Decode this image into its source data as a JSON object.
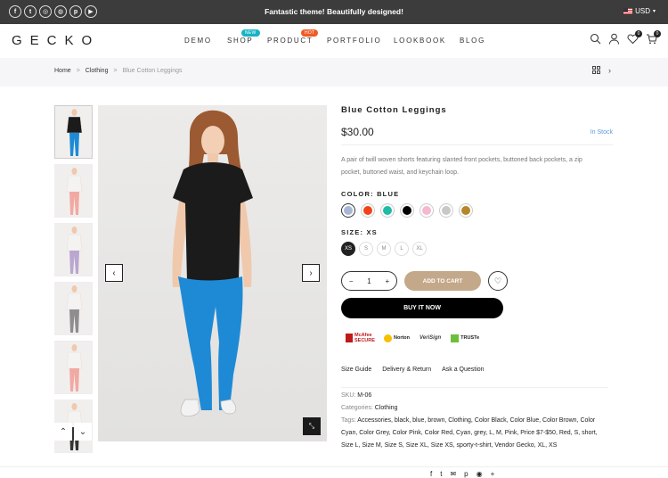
{
  "topbar": {
    "message": "Fantastic theme! Beautifully designed!",
    "currency": "USD",
    "social_icons": [
      "facebook-icon",
      "twitter-icon",
      "instagram-icon",
      "dribbble-icon",
      "pinterest-icon",
      "youtube-icon"
    ],
    "social_glyphs": [
      "f",
      "t",
      "◎",
      "◍",
      "p",
      "▶"
    ]
  },
  "header": {
    "logo": "GECKO",
    "nav": [
      {
        "label": "DEMO"
      },
      {
        "label": "SHOP",
        "badge": "NEW",
        "badge_color": "#16b3c4"
      },
      {
        "label": "PRODUCT",
        "badge": "HOT",
        "badge_color": "#f15a24"
      },
      {
        "label": "PORTFOLIO"
      },
      {
        "label": "LOOKBOOK"
      },
      {
        "label": "BLOG"
      }
    ],
    "wishlist_count": "0",
    "cart_count": "0"
  },
  "breadcrumb": {
    "home": "Home",
    "category": "Clothing",
    "current": "Blue Cotton Leggings",
    "sep": ">"
  },
  "gallery": {
    "prev": "‹",
    "next": "›",
    "thumb_up": "⌃",
    "thumb_down": "⌄",
    "expand": "⤡",
    "thumb_leg_colors": [
      "#1e8ad6",
      "#f2a9a3",
      "#b9a7cf",
      "#8e8e8e",
      "#f2a9a3",
      "#333333"
    ]
  },
  "product": {
    "title": "Blue Cotton Leggings",
    "price": "$30.00",
    "stock": "In Stock",
    "description": "A pair of twill woven shorts featuring slanted front pockets, buttoned back pockets, a zip pocket, buttoned waist, and keychain loop.",
    "color_label": "COLOR: BLUE",
    "colors": [
      "#a7b6d3",
      "#f2421a",
      "#1fbba6",
      "#000000",
      "#f5b8d1",
      "#c8c8c8",
      "#b5872a"
    ],
    "size_label": "SIZE: XS",
    "sizes": [
      "XS",
      "S",
      "M",
      "L",
      "XL"
    ],
    "quantity": "1",
    "qty_minus": "−",
    "qty_plus": "+",
    "add_to_cart": "ADD TO CART",
    "buy_now": "BUY IT NOW",
    "wishlist_glyph": "♡"
  },
  "trust_badges": [
    "McAfee SECURE",
    "Norton",
    "VeriSign",
    "TRUSTe"
  ],
  "tabs": [
    "Size Guide",
    "Delivery & Return",
    "Ask a Question"
  ],
  "meta": {
    "sku_label": "SKU:",
    "sku": "M-06",
    "categories_label": "Categories:",
    "categories": "Clothing",
    "tags_label": "Tags:",
    "tags": "Accessories, black, blue, brown, Clothing, Color Black, Color Blue, Color Brown, Color Cyan, Color Grey, Color Pink, Color Red, Cyan, grey, L, M, Pink, Price $7-$50, Red, S, short, Size L, Size M, Size S, Size XL, Size XS, sporty-t-shirt, Vendor Gecko, XL, XS"
  },
  "share": [
    "f",
    "t",
    "✉",
    "p",
    "◉",
    "+"
  ]
}
